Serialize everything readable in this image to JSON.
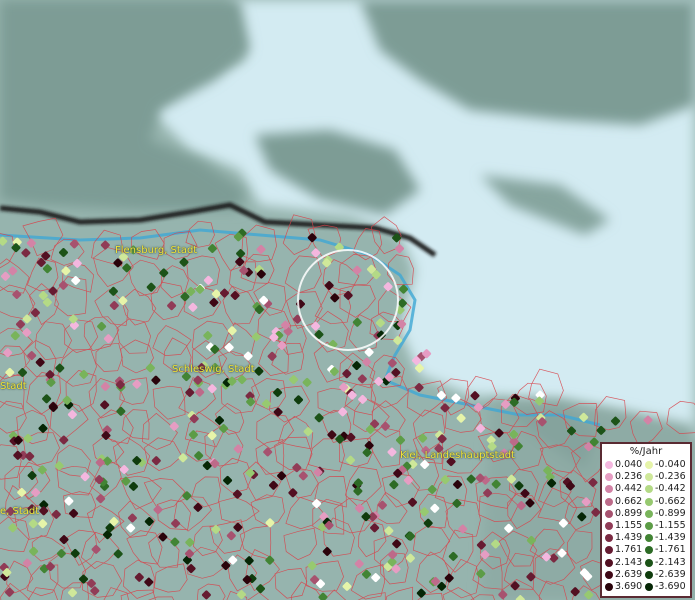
{
  "map": {
    "places": [
      {
        "id": "flensburg",
        "label": "Flensburg, Stadt"
      },
      {
        "id": "schleswig",
        "label": "Schleswig, Stadt"
      },
      {
        "id": "kiel",
        "label": "Kiel, Landeshauptstadt"
      },
      {
        "id": "left-top",
        "label": "Stadt"
      },
      {
        "id": "left-bottom",
        "label": "e, Stadt"
      }
    ]
  },
  "legend": {
    "title": "%/Jahr",
    "positive": [
      {
        "label": "0.040",
        "color": "#f4b7df"
      },
      {
        "label": "0.236",
        "color": "#e69dc3"
      },
      {
        "label": "0.442",
        "color": "#d383a6"
      },
      {
        "label": "0.662",
        "color": "#bd6a89"
      },
      {
        "label": "0.899",
        "color": "#a7526f"
      },
      {
        "label": "1.155",
        "color": "#913c57"
      },
      {
        "label": "1.439",
        "color": "#7b2a42"
      },
      {
        "label": "1.761",
        "color": "#661b31"
      },
      {
        "label": "2.143",
        "color": "#531022"
      },
      {
        "label": "2.639",
        "color": "#3f0816"
      },
      {
        "label": "3.690",
        "color": "#2a030b"
      }
    ],
    "negative": [
      {
        "label": "-0.040",
        "color": "#e6f4a9"
      },
      {
        "label": "-0.236",
        "color": "#cfe89a"
      },
      {
        "label": "-0.442",
        "color": "#b4da86"
      },
      {
        "label": "-0.662",
        "color": "#97c970"
      },
      {
        "label": "-0.899",
        "color": "#79b45b"
      },
      {
        "label": "-1.155",
        "color": "#5c9c46"
      },
      {
        "label": "-1.439",
        "color": "#428434"
      },
      {
        "label": "-1.761",
        "color": "#2d6b25"
      },
      {
        "label": "-2.143",
        "color": "#1c5318"
      },
      {
        "label": "-2.639",
        "color": "#0f3c0d"
      },
      {
        "label": "-3.690",
        "color": "#052605"
      }
    ]
  },
  "colors": {
    "sea": "#d8edf4",
    "land": "#8eaba5",
    "border": "#e0414b",
    "coast": "#3fa7d4"
  }
}
